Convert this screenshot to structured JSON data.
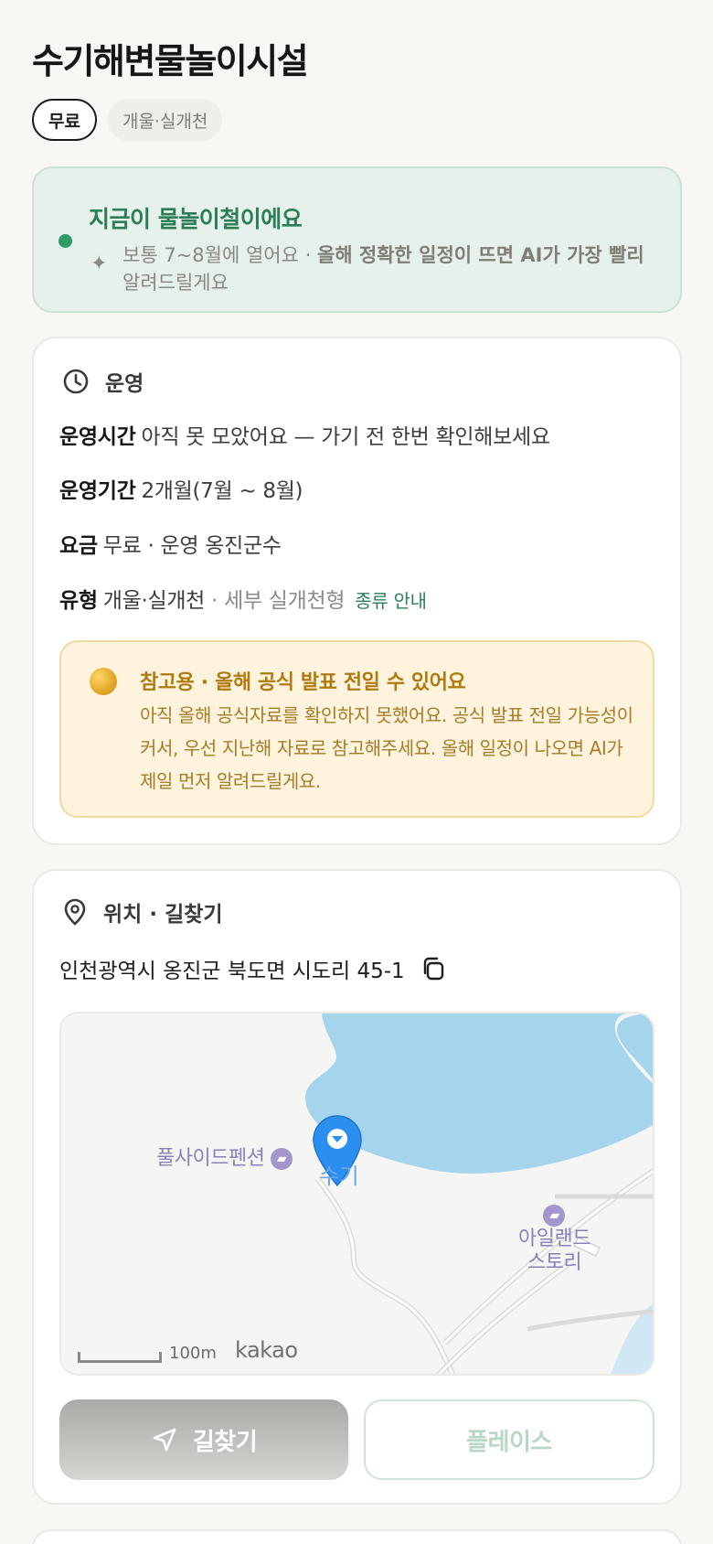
{
  "header": {
    "title": "수기해변물놀이시설",
    "chips": [
      "무료",
      "개울·실개천"
    ]
  },
  "season_banner": {
    "headline": "지금이 물놀이철이에요",
    "desc_plain": "보통 7~8월에 열어요 · ",
    "desc_bold": "올해 정확한 일정이 뜨면 AI가 가장 빨리",
    "desc_tail": "알려드릴게요"
  },
  "operation": {
    "section_title": "운영",
    "hours_key": "운영시간",
    "hours_value": "아직 못 모았어요 — 가기 전 한번 확인해보세요",
    "period_key": "운영기간",
    "period_value": "2개월(7월 ~ 8월)",
    "fee_key": "요금",
    "fee_value": "무료 · 운영 옹진군수",
    "type_key": "유형",
    "type_value": "개울·실개천",
    "type_detail": " · 세부 실개천형",
    "type_link": "종류 안내",
    "notice_title": "참고용 · 올해 공식 발표 전일 수 있어요",
    "notice_body": "아직 올해 공식자료를 확인하지 못했어요. 공식 발표 전일 가능성이 커서, 우선 지난해 자료로 참고해주세요. 올해 일정이 나오면 AI가 제일 먼저 알려드릴게요."
  },
  "location": {
    "section_title": "위치 · 길찾기",
    "address": "인천광역시 옹진군 북도면 시도리 45-1",
    "map": {
      "poi_1": "풀사이드펜션",
      "poi_pin": "수기",
      "poi_2_line1": "아일랜드",
      "poi_2_line2": "스토리",
      "scale": "100m",
      "brand": "kakao"
    },
    "nav_button": "길찾기",
    "place_button": "플레이스"
  },
  "colors": {
    "accent_green": "#2b7e56",
    "banner_bg": "#e5f1ea",
    "notice_bg": "#fef3dc",
    "notice_text": "#b07a10",
    "water": "#a5d5ec",
    "pin": "#2b8ff0"
  }
}
